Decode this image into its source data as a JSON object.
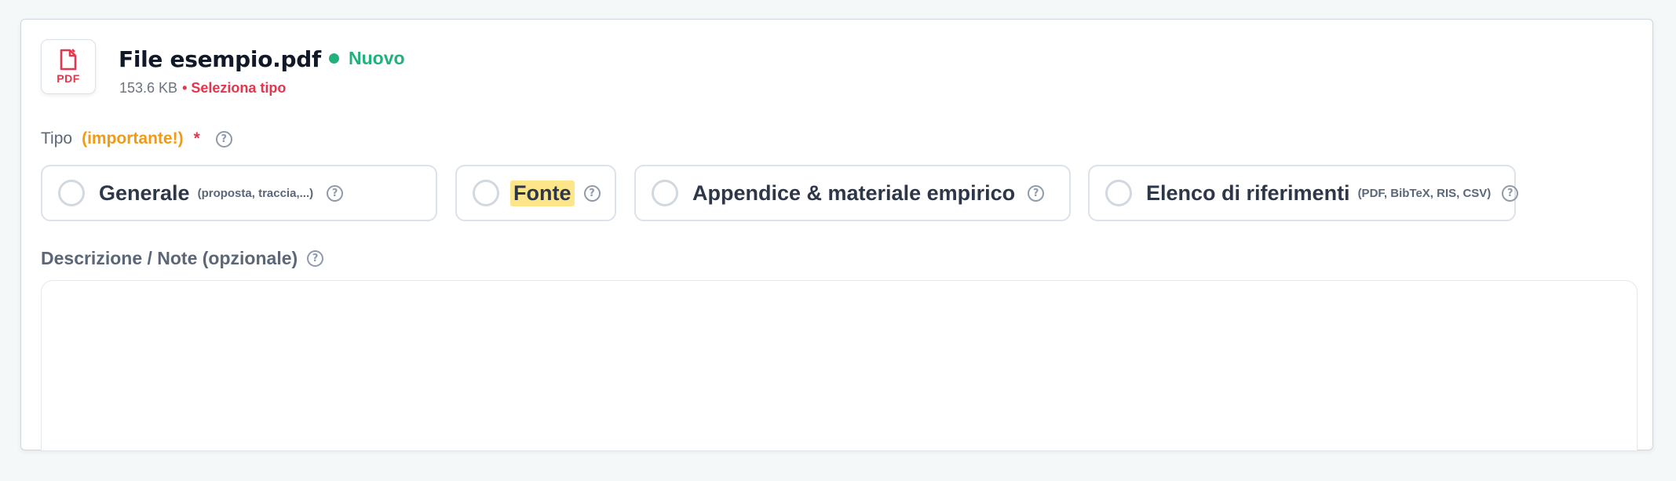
{
  "file": {
    "icon": "pdf-file-icon",
    "type_badge": "PDF",
    "name": "File esempio.pdf",
    "status": "Nuovo",
    "size": "153.6 KB",
    "select_prompt": "• Seleziona tipo"
  },
  "type_field": {
    "label": "Tipo",
    "importance": "(importante!)",
    "required_mark": "*",
    "help": "?",
    "options": [
      {
        "label": "Generale",
        "hint": "(proposta, traccia,...)",
        "help": "?"
      },
      {
        "label": "Fonte",
        "hint": "",
        "help": "?"
      },
      {
        "label": "Appendice & materiale empirico",
        "hint": "",
        "help": "?"
      },
      {
        "label": "Elenco di riferimenti",
        "hint": "(PDF, BibTeX, RIS, CSV)",
        "help": "?"
      }
    ]
  },
  "description": {
    "label": "Descrizione / Note (opzionale)",
    "help": "?",
    "value": ""
  },
  "colors": {
    "accent_green": "#22b07d",
    "accent_red": "#e5364d",
    "accent_orange": "#f29a12",
    "highlight": "#fde68a"
  }
}
